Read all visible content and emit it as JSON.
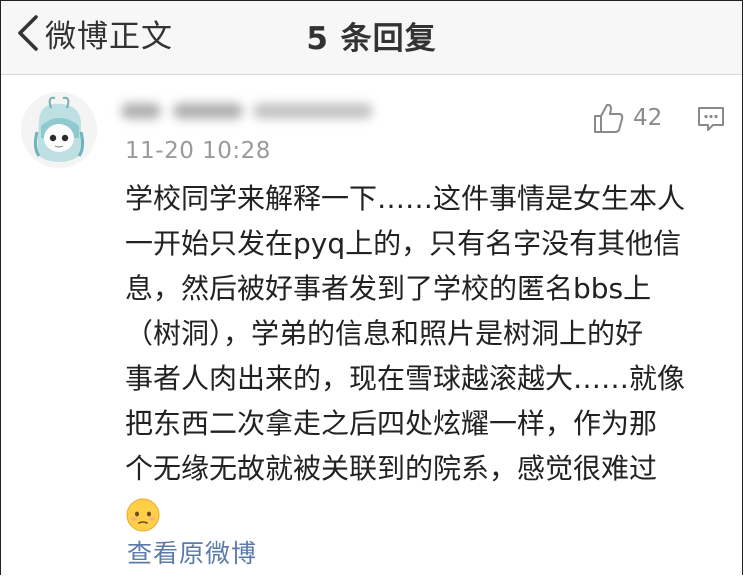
{
  "navbar": {
    "back_label": "微博正文",
    "title": "5 条回复"
  },
  "comment": {
    "username": "",
    "timestamp": "11-20 10:28",
    "like_count": "42",
    "body_lines": [
      "学校同学来解释一下……这件事情是女生本人",
      "一开始只发在pyq上的，只有名字没有其他信",
      "息，然后被好事者发到了学校的匿名bbs上",
      "（树洞），学弟的信息和照片是树洞上的好",
      "事者人肉出来的，现在雪球越滚越大……就像",
      "把东西二次拿走之后四处炫耀一样，作为那",
      "个无缘无故就被关联到的院系，感觉很难过"
    ],
    "view_original": "查看原微博"
  },
  "icons": {
    "back": "chevron-left-icon",
    "like": "thumbs-up-icon",
    "reply": "comment-icon",
    "emoji": "sad-face-emoji"
  },
  "colors": {
    "navbar_bg": "#f7f7f7",
    "link": "#5b7bab",
    "meta": "#9a9a9a"
  }
}
